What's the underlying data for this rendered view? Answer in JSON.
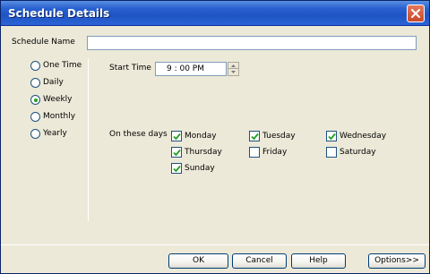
{
  "window": {
    "title": "Schedule Details",
    "accent_color": "#2a62d0",
    "close_icon": "close-icon"
  },
  "form": {
    "schedule_name_label": "Schedule Name",
    "schedule_name_value": "",
    "start_time_label": "Start Time",
    "start_time_value": "9 : 00 PM",
    "days_label": "On these days"
  },
  "frequency": {
    "options": [
      {
        "label": "One Time",
        "selected": false
      },
      {
        "label": "Daily",
        "selected": false
      },
      {
        "label": "Weekly",
        "selected": true
      },
      {
        "label": "Monthly",
        "selected": false
      },
      {
        "label": "Yearly",
        "selected": false
      }
    ]
  },
  "days": [
    {
      "label": "Monday",
      "checked": true
    },
    {
      "label": "Tuesday",
      "checked": true
    },
    {
      "label": "Wednesday",
      "checked": true
    },
    {
      "label": "Thursday",
      "checked": true
    },
    {
      "label": "Friday",
      "checked": false
    },
    {
      "label": "Saturday",
      "checked": false
    },
    {
      "label": "Sunday",
      "checked": true
    }
  ],
  "buttons": {
    "ok": "OK",
    "cancel": "Cancel",
    "help": "Help",
    "options": "Options>>"
  }
}
